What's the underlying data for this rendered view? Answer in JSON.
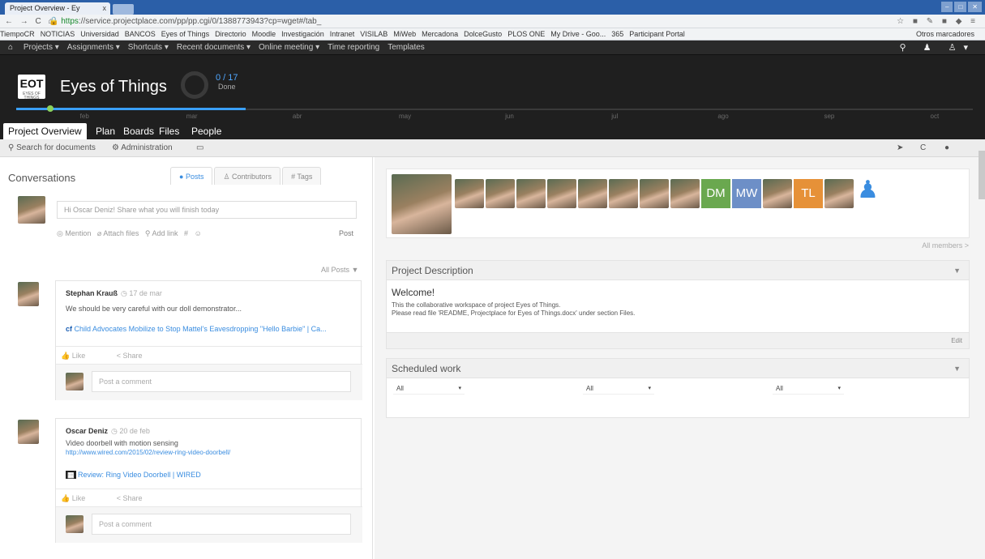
{
  "browser": {
    "tab_title": "Project Overview - Ey",
    "tab_close": "x",
    "nav_buttons": "← → C ⌂",
    "url_secure": "https",
    "url_rest": "://service.projectplace.com/pp/pp.cgi/0/1388773943?cp=wget#/tab_",
    "bookmarks": [
      "TiempoCR",
      "NOTICIAS",
      "Universidad",
      "BANCOS",
      "Eyes of Things",
      "Directorio",
      "Moodle",
      "Investigación",
      "Intranet",
      "VISILAB",
      "MiWeb",
      "Mercadona",
      "DolceGusto",
      "PLOS ONE",
      "My Drive - Goo...",
      "365",
      "Participant Portal"
    ],
    "other_bookmarks": "Otros marcadores"
  },
  "topnav": {
    "items": [
      "Projects ▾",
      "Assignments ▾",
      "Shortcuts ▾",
      "Recent documents ▾",
      "Online meeting ▾",
      "Time reporting",
      "Templates"
    ]
  },
  "header": {
    "logo": "EOT",
    "logo_sub": "EYES OF THINGS",
    "project_name": "Eyes of Things",
    "progress_count": "0 / 17",
    "progress_label": "Done",
    "months": [
      "feb",
      "mar",
      "abr",
      "may",
      "jun",
      "jul",
      "ago",
      "sep",
      "oct"
    ],
    "progress_fraction": 0.24
  },
  "tabs": [
    "Project Overview",
    "Plan",
    "Boards",
    "Files",
    "People"
  ],
  "toolbar": {
    "search": "Search for documents",
    "admin": "Administration"
  },
  "conversations": {
    "title": "Conversations",
    "tabs": [
      "Posts",
      "Contributors",
      "Tags"
    ],
    "composer_placeholder": "Hi Oscar Deniz! Share what you will finish today",
    "composer_actions": [
      "Mention",
      "Attach files",
      "Add link",
      "#",
      "☺"
    ],
    "post_button": "Post",
    "filter": "All Posts ▼",
    "posts": [
      {
        "author": "Stephan Krauß",
        "date": "17 de mar",
        "text": "We should be very careful with our doll demonstrator...",
        "link": "Child Advocates Mobilize to Stop Mattel's Eavesdropping \"Hello Barbie\" | Ca...",
        "link_url": "",
        "like": "Like",
        "share": "Share",
        "comment_placeholder": "Post a comment"
      },
      {
        "author": "Oscar Deniz",
        "date": "20 de feb",
        "text": "Video doorbell with motion sensing",
        "link_url": "http://www.wired.com/2015/02/review-ring-video-doorbell/",
        "link": "Review: Ring Video Doorbell | WIRED",
        "like": "Like",
        "share": "Share",
        "comment_placeholder": "Post a comment"
      }
    ]
  },
  "members": {
    "initials": [
      "DM",
      "MW",
      "TL"
    ],
    "initials_colors": [
      "#6aa84f",
      "#6d8fc7",
      "#e69138"
    ],
    "all_members": "All members >"
  },
  "project_description": {
    "title": "Project Description",
    "welcome": "Welcome!",
    "line1": "This the collaborative workspace of project Eyes of Things.",
    "line2": "Please read file 'README, Projectplace for Eyes of Things.docx' under section Files.",
    "edit": "Edit"
  },
  "scheduled_work": {
    "title": "Scheduled work",
    "filters": [
      "All",
      "All",
      "All"
    ]
  },
  "colors": {
    "accent": "#3a8de0",
    "header_bg": "#1f1f1f"
  }
}
